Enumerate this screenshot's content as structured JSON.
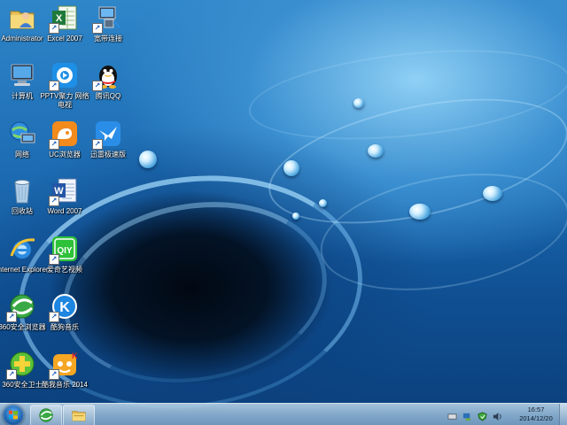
{
  "desktop_icons": [
    {
      "label": "Administrator",
      "icon": "user-folder-icon"
    },
    {
      "label": "Excel 2007",
      "icon": "excel-icon"
    },
    {
      "label": "宽带连接",
      "icon": "network-connection-icon"
    },
    {
      "label": "计算机",
      "icon": "computer-icon"
    },
    {
      "label": "PPTV聚力 网络电视",
      "icon": "pptv-icon"
    },
    {
      "label": "腾讯QQ",
      "icon": "qq-penguin-icon"
    },
    {
      "label": "网络",
      "icon": "network-globe-icon"
    },
    {
      "label": "UC浏览器",
      "icon": "uc-browser-icon"
    },
    {
      "label": "迅雷极速版",
      "icon": "xunlei-bird-icon"
    },
    {
      "label": "回收站",
      "icon": "recycle-bin-icon"
    },
    {
      "label": "Word 2007",
      "icon": "word-icon"
    },
    {
      "label": "Internet Explorer",
      "icon": "ie-icon"
    },
    {
      "label": "爱奇艺视频",
      "icon": "iqiyi-icon"
    },
    {
      "label": "360安全浏览器",
      "icon": "360-browser-icon"
    },
    {
      "label": "酷狗音乐",
      "icon": "kugou-icon"
    },
    {
      "label": "360安全卫士",
      "icon": "360-safe-icon"
    },
    {
      "label": "酷我音乐 2014",
      "icon": "kuwo-icon"
    }
  ],
  "taskbar": {
    "start_icon": "windows-logo-icon",
    "pinned": [
      {
        "name": "360 browser",
        "icon": "360-browser-icon"
      },
      {
        "name": "explorer",
        "icon": "folder-icon"
      }
    ],
    "tray_icons": [
      "flag-icon",
      "network-icon",
      "shield-icon",
      "volume-icon"
    ],
    "clock_time": "16:57",
    "clock_date": "2014/12/20"
  }
}
